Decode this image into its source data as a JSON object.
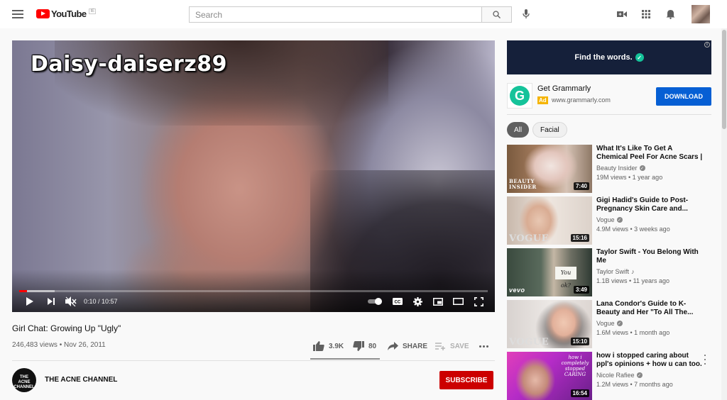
{
  "header": {
    "logo_text": "YouTube",
    "logo_superscript": "IE",
    "search_placeholder": "Search"
  },
  "player": {
    "overlay_title": "Daisy-daiserz89",
    "time_display": "0:10 / 10:57",
    "played_fraction": 0.016,
    "loaded_fraction": 0.075
  },
  "video": {
    "title": "Girl Chat: Growing Up \"Ugly\"",
    "meta": "246,483 views • Nov 26, 2011",
    "likes": "3.9K",
    "dislikes": "80",
    "share_label": "SHARE",
    "save_label": "SAVE",
    "like_ratio": 0.98
  },
  "channel": {
    "name": "THE ACNE CHANNEL",
    "avatar_text_line1": "THE",
    "avatar_text_line2": "ACNE",
    "avatar_text_line3": "CHANNEL",
    "subscribe_label": "SUBSCRIBE"
  },
  "ad": {
    "banner_text": "Find the words.",
    "title": "Get Grammarly",
    "badge": "Ad",
    "url": "www.grammarly.com",
    "button": "DOWNLOAD",
    "logo_letter": "G",
    "brand_color": "#15c39a"
  },
  "chips": [
    {
      "label": "All",
      "active": true
    },
    {
      "label": "Facial",
      "active": false
    }
  ],
  "recommendations": [
    {
      "title": "What It's Like To Get A Chemical Peel For Acne Scars | Beauty...",
      "channel": "Beauty Insider",
      "verified": true,
      "views": "19M views • 1 year ago",
      "duration": "7:40",
      "thumb_text": "BEAUTY INSIDER"
    },
    {
      "title": "Gigi Hadid's Guide to Post-Pregnancy Skin Care and...",
      "channel": "Vogue",
      "verified": true,
      "views": "4.9M views • 3 weeks ago",
      "duration": "15:16",
      "thumb_text": "VOGUE"
    },
    {
      "title": "Taylor Swift - You Belong With Me",
      "channel": "Taylor Swift",
      "verified": false,
      "music": true,
      "views": "1.1B views • 11 years ago",
      "duration": "3:49",
      "thumb_text": "vevo",
      "thumb_note": "You ok?"
    },
    {
      "title": "Lana Condor's Guide to K-Beauty and Her \"To All The...",
      "channel": "Vogue",
      "verified": true,
      "views": "1.6M views • 1 month ago",
      "duration": "15:10",
      "thumb_text": "VOGUE"
    },
    {
      "title": "how i stopped caring about ppl's opinions + how u can too.",
      "channel": "Nicole Rafiee",
      "verified": true,
      "views": "1.2M views • 7 months ago",
      "duration": "16:54",
      "thumb_text": "how i completely stopped CARING"
    }
  ],
  "colors": {
    "accent_red": "#ff0000",
    "subscribe_red": "#cc0000",
    "download_blue": "#065fd4"
  }
}
